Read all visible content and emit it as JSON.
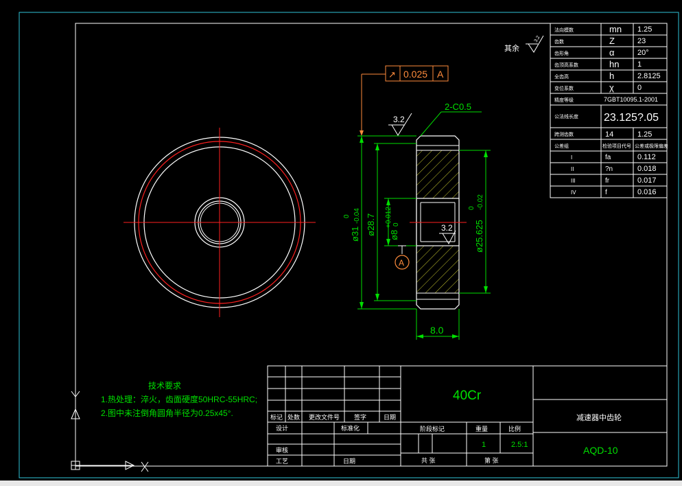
{
  "colors": {
    "background": "#000000",
    "frame": "#2fc4d8",
    "lines": "#ffffff",
    "center_lines": "#ff2020",
    "dimensions": "#00e000",
    "hatch": "#c8c830",
    "annotation": "#ff8c3c",
    "table_text": "#ffffff"
  },
  "drawing": {
    "surface_roughness_rest_label": "其余",
    "surface_roughness_rest_value": "3.2",
    "tolerance_frame": {
      "symbol": "↗",
      "value": "0.025",
      "datum": "A"
    },
    "chamfer_label": "2-C0.5",
    "roughness_top": "3.2",
    "roughness_bore": "3.2",
    "datum_marker": "A",
    "dimensions": {
      "d_outer_base": "ø31",
      "d_outer_tol_upper": "0",
      "d_outer_tol_lower": "-0.04",
      "d_root": "ø28.7",
      "d_bore_base": "ø8",
      "d_bore_tol_upper": "+0.012",
      "d_bore_tol_lower": "0",
      "d_pitch_base": "ø25.625",
      "d_pitch_tol_upper": "0",
      "d_pitch_tol_lower": "-0.02",
      "width": "8.0"
    }
  },
  "param_table": {
    "rows": [
      {
        "name": "法向模数",
        "symbol": "mn",
        "value": "1.25"
      },
      {
        "name": "齿数",
        "symbol": "Z",
        "value": "23"
      },
      {
        "name": "齿形角",
        "symbol": "α",
        "value": "20°"
      },
      {
        "name": "齿顶高系数",
        "symbol": "hn",
        "value": "1"
      },
      {
        "name": "全齿高",
        "symbol": "h",
        "value": "2.8125"
      },
      {
        "name": "变位系数",
        "symbol": "χ",
        "value": "0"
      },
      {
        "name": "精度等级",
        "symbol": "",
        "value": "7GBT10095.1-2001"
      },
      {
        "name": "公法线长度",
        "symbol": "",
        "value": "23.125?.05"
      },
      {
        "name": "跨测齿数",
        "symbol": "14",
        "value": "1.25"
      }
    ],
    "check_header": [
      "公差组",
      "检验项目代号",
      "公差或极限偏差"
    ],
    "check_rows": [
      {
        "group": "I",
        "symbol": "fa",
        "value": "0.112"
      },
      {
        "group": "II",
        "symbol": "?n",
        "value": "0.018"
      },
      {
        "group": "III",
        "symbol": "fr",
        "value": "0.017"
      },
      {
        "group": "IV",
        "symbol": "f",
        "value": "0.016"
      }
    ]
  },
  "tech_requirements": {
    "title": "技术要求",
    "items": [
      "1.热处理：淬火，齿面硬度50HRC-55HRC;",
      "2.图中未注倒角圆角半径为0.25x45°."
    ]
  },
  "title_block": {
    "material": "40Cr",
    "part_name": "减速器中齿轮",
    "drawing_no": "AQD-10",
    "quantity": "1",
    "scale": "2.5:1",
    "labels": {
      "mark": "标记",
      "count": "处数",
      "change_doc": "更改文件号",
      "signature": "签字",
      "date": "日期",
      "design": "设计",
      "standardize": "标准化",
      "stage_mark": "阶段标记",
      "weight": "重量",
      "ratio": "比例",
      "review": "审核",
      "process": "工艺",
      "date2": "日期",
      "sheets_total": "共 张",
      "sheet_no": "第 张"
    }
  }
}
